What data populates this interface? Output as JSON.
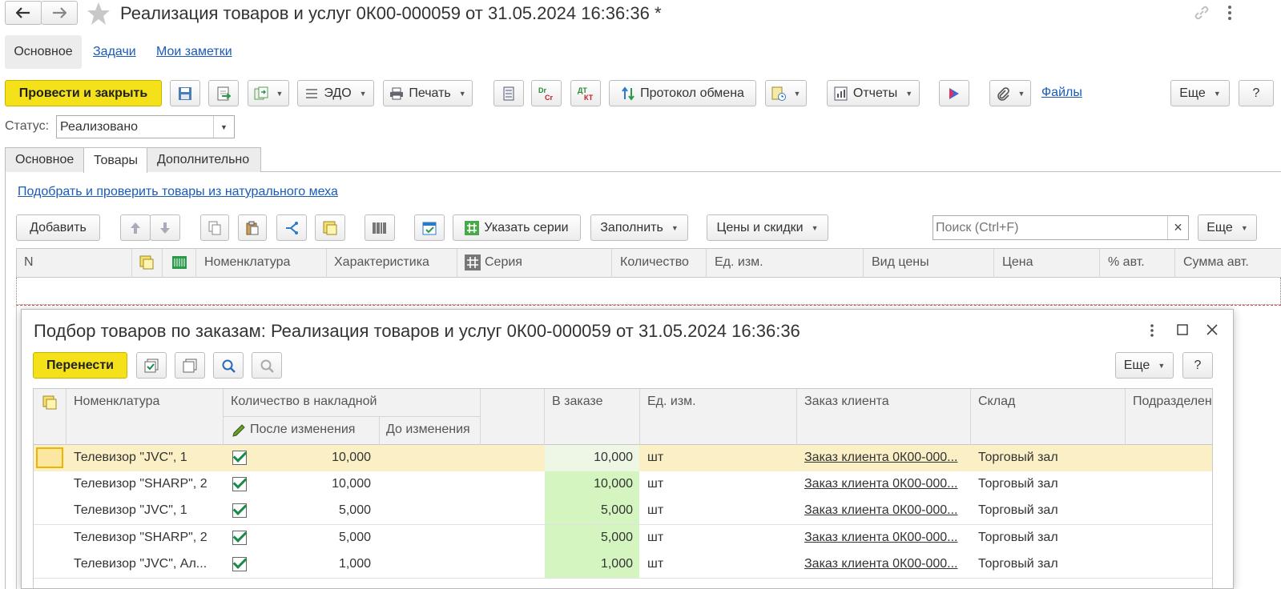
{
  "window": {
    "title": "Реализация товаров и услуг 0К00-000059 от 31.05.2024 16:36:36 *"
  },
  "nav_tabs": [
    "Основное",
    "Задачи",
    "Мои заметки"
  ],
  "toolbar": {
    "post_close": "Провести и закрыть",
    "edo": "ЭДО",
    "print": "Печать",
    "exchange_log": "Протокол обмена",
    "reports": "Отчеты",
    "files": "Файлы",
    "more": "Еще",
    "help": "?",
    "dt_kt": "Dr Cr",
    "dt_kt2": "Дт Кт"
  },
  "status": {
    "label": "Статус:",
    "value": "Реализовано"
  },
  "doc_tabs": [
    "Основное",
    "Товары",
    "Дополнительно"
  ],
  "fur_link": "Подобрать и проверить товары из натурального меха",
  "goods_toolbar": {
    "add": "Добавить",
    "series": "Указать серии",
    "fill": "Заполнить",
    "prices": "Цены и скидки",
    "search_placeholder": "Поиск (Ctrl+F)",
    "search_clear": "×",
    "more": "Еще"
  },
  "goods_columns": [
    "N",
    "Номенклатура",
    "Характеристика",
    "Серия",
    "Количество",
    "Ед. изм.",
    "Вид цены",
    "Цена",
    "% авт.",
    "Сумма авт."
  ],
  "dialog": {
    "title": "Подбор товаров по заказам: Реализация товаров и услуг 0К00-000059 от 31.05.2024 16:36:36",
    "transfer": "Перенести",
    "more": "Еще",
    "help": "?",
    "columns": {
      "nomenclature": "Номенклатура",
      "qty_invoice": "Количество в накладной",
      "after": "После изменения",
      "before": "До изменения",
      "in_order": "В заказе",
      "unit": "Ед. изм.",
      "order": "Заказ клиента",
      "warehouse": "Склад",
      "division": "Подразделен"
    },
    "rows": [
      {
        "name": "Телевизор \"JVC\", 1",
        "after": "10,000",
        "before": "",
        "in_order": "10,000",
        "unit": "шт",
        "order": "Заказ клиента 0К00-000...",
        "warehouse": "Торговый зал",
        "checked": true
      },
      {
        "name": "Телевизор \"SHARP\", 2",
        "after": "10,000",
        "before": "",
        "in_order": "10,000",
        "unit": "шт",
        "order": "Заказ клиента 0К00-000...",
        "warehouse": "Торговый зал",
        "checked": true
      },
      {
        "name": "Телевизор \"JVC\", 1",
        "after": "5,000",
        "before": "",
        "in_order": "5,000",
        "unit": "шт",
        "order": "Заказ клиента 0К00-000...",
        "warehouse": "Торговый зал",
        "checked": true
      },
      {
        "name": "Телевизор \"SHARP\", 2",
        "after": "5,000",
        "before": "",
        "in_order": "5,000",
        "unit": "шт",
        "order": "Заказ клиента 0К00-000...",
        "warehouse": "Торговый зал",
        "checked": true
      },
      {
        "name": "Телевизор \"JVC\", Ал...",
        "after": "1,000",
        "before": "",
        "in_order": "1,000",
        "unit": "шт",
        "order": "Заказ клиента 0К00-000...",
        "warehouse": "Торговый зал",
        "checked": true
      }
    ]
  },
  "colors": {
    "accent_yellow": "#f4e119",
    "link": "#1a5bb8",
    "selected_row": "#fbefc6",
    "green_cell": "#d4f5c0"
  }
}
